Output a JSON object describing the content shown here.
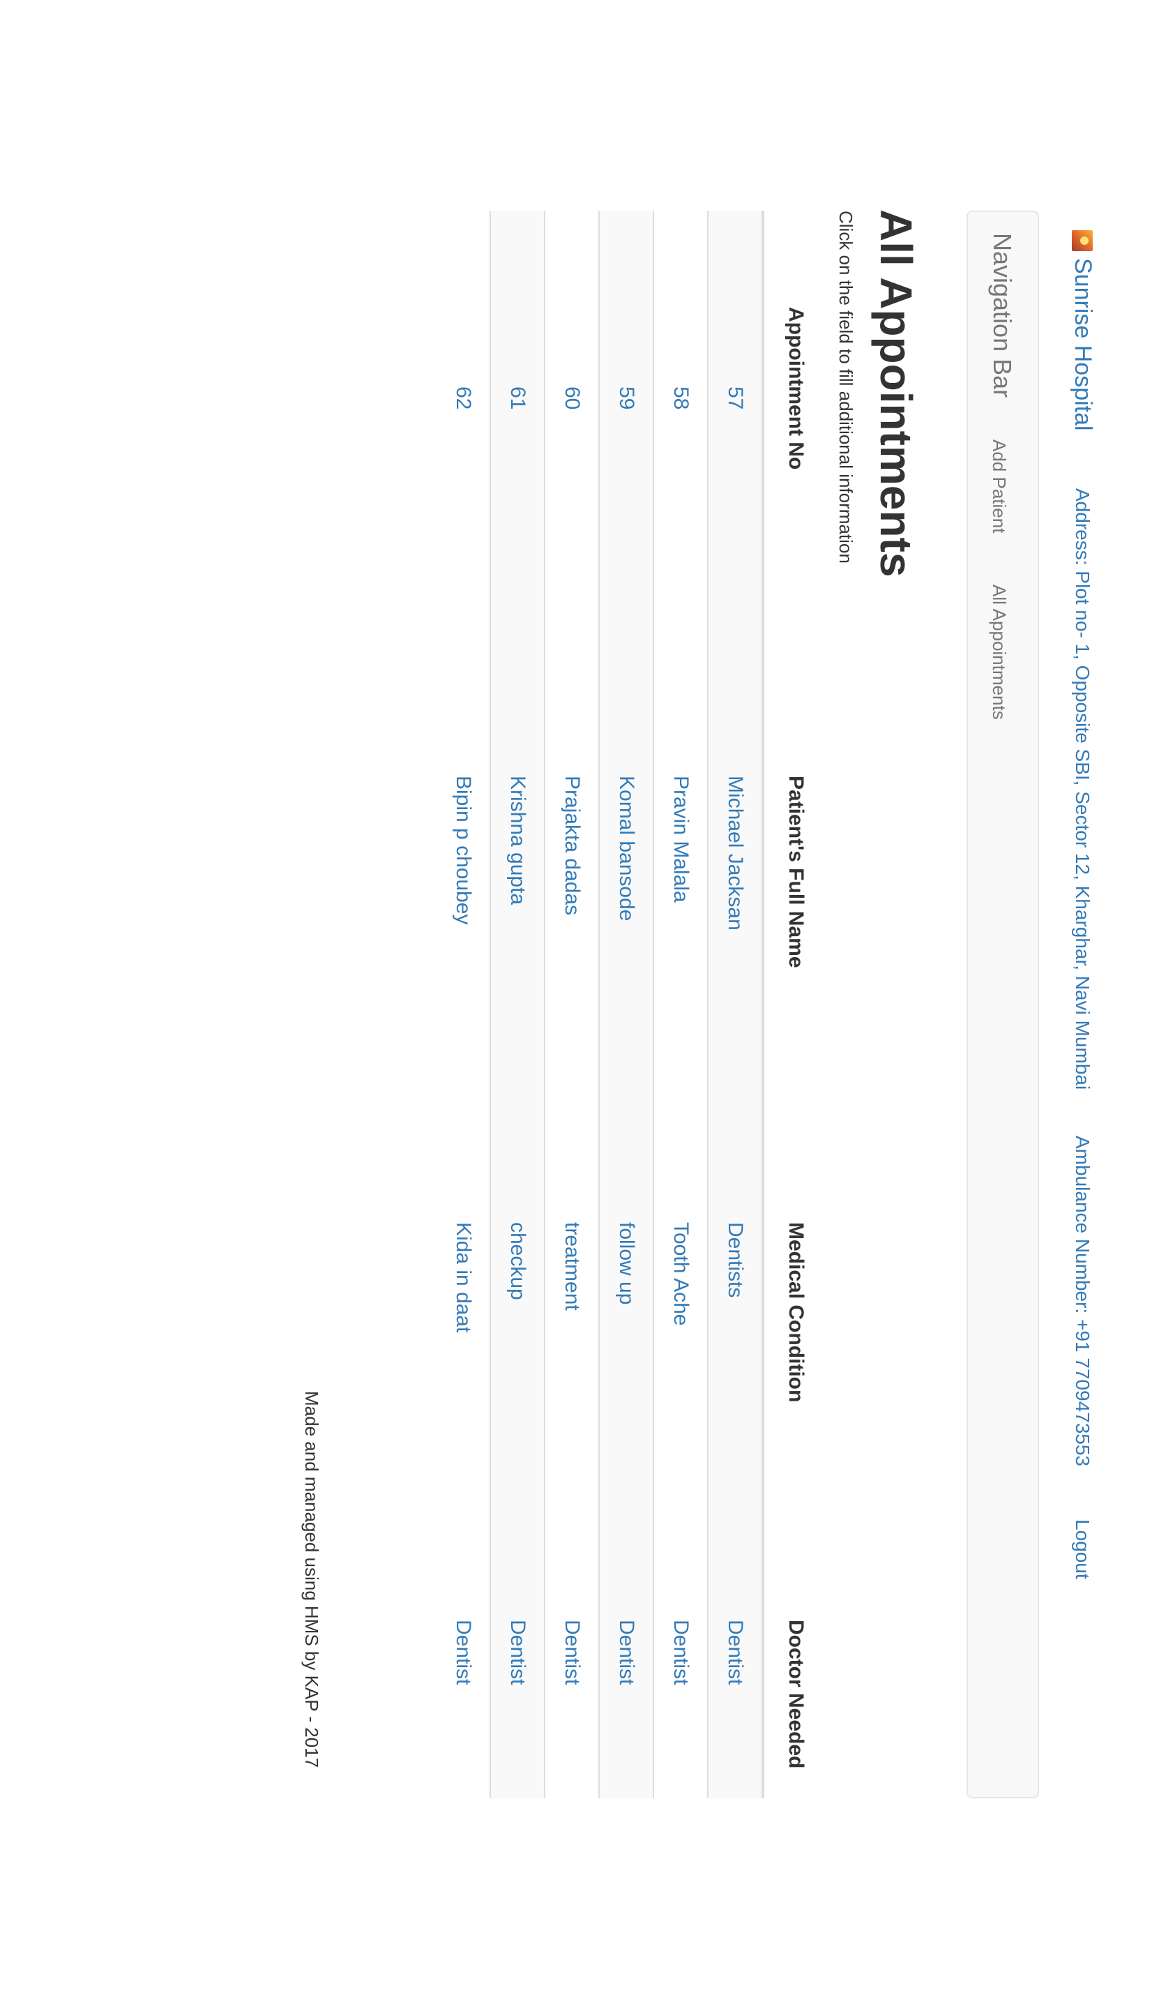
{
  "header": {
    "brand_name": "Sunrise Hospital",
    "address": "Address: Plot no- 1, Opposite SBI, Sector 12, Kharghar, Navi Mumbai",
    "ambulance": "Ambulance Number: +91 7709473553",
    "logout": "Logout"
  },
  "nav": {
    "brand": "Navigation Bar",
    "links": [
      "Add Patient",
      "All Appointments"
    ]
  },
  "page": {
    "title": "All Appointments",
    "subtitle": "Click on the field to fill additional information"
  },
  "table": {
    "headers": [
      "Appointment No",
      "Patient's Full Name",
      "Medical Condition",
      "Doctor Needed"
    ],
    "rows": [
      {
        "no": "57",
        "name": "Michael Jacksan",
        "condition": "Dentists",
        "doctor": "Dentist"
      },
      {
        "no": "58",
        "name": "Pravin Malala",
        "condition": "Tooth Ache",
        "doctor": "Dentist"
      },
      {
        "no": "59",
        "name": "Komal bansode",
        "condition": "follow up",
        "doctor": "Dentist"
      },
      {
        "no": "60",
        "name": "Prajakta dadas",
        "condition": "treatment",
        "doctor": "Dentist"
      },
      {
        "no": "61",
        "name": "Krishna gupta",
        "condition": "checkup",
        "doctor": "Dentist"
      },
      {
        "no": "62",
        "name": "Bipin p choubey",
        "condition": "Kida in daat",
        "doctor": "Dentist"
      }
    ]
  },
  "footer": {
    "text": "Made and managed using HMS by KAP - 2017"
  },
  "colors": {
    "link": "#337ab7",
    "text": "#333333",
    "nav_text": "#777777",
    "nav_bg": "#f8f8f8",
    "stripe_bg": "#f9f9f9"
  }
}
